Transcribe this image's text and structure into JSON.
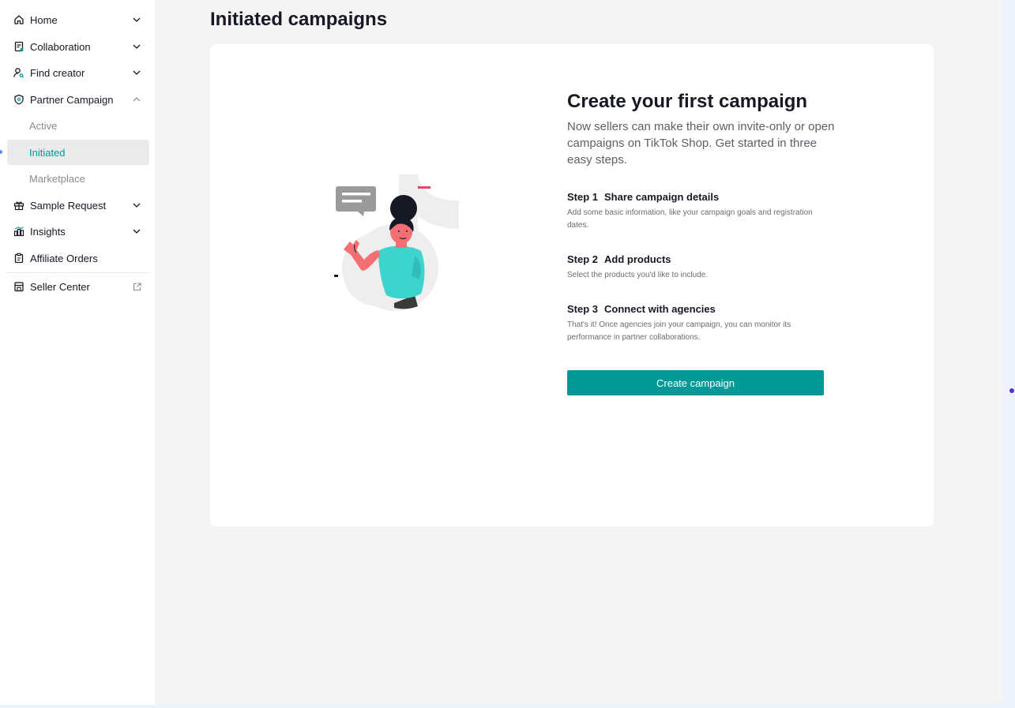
{
  "sidebar": {
    "items": [
      {
        "label": "Home",
        "icon": "home-icon"
      },
      {
        "label": "Collaboration",
        "icon": "document-icon"
      },
      {
        "label": "Find creator",
        "icon": "user-search-icon"
      },
      {
        "label": "Partner Campaign",
        "icon": "shield-icon"
      },
      {
        "label": "Sample Request",
        "icon": "gift-icon"
      },
      {
        "label": "Insights",
        "icon": "chart-icon"
      },
      {
        "label": "Affiliate Orders",
        "icon": "clipboard-icon"
      },
      {
        "label": "Seller Center",
        "icon": "store-icon"
      }
    ],
    "sub_items": [
      {
        "label": "Active"
      },
      {
        "label": "Initiated"
      },
      {
        "label": "Marketplace"
      }
    ]
  },
  "page": {
    "title": "Initiated campaigns"
  },
  "empty_state": {
    "title": "Create your first campaign",
    "description": "Now sellers can make their own invite-only or open campaigns on TikTok Shop. Get started in three easy steps.",
    "steps": [
      {
        "number": "Step 1",
        "title": "Share campaign details",
        "description": "Add some basic information, like your campaign goals and registration dates."
      },
      {
        "number": "Step 2",
        "title": "Add products",
        "description": "Select the products you'd like to include."
      },
      {
        "number": "Step 3",
        "title": "Connect with agencies",
        "description": "That's it! Once agencies join your campaign, you can monitor its performance in partner collaborations."
      }
    ],
    "button_label": "Create campaign"
  },
  "colors": {
    "accent": "#009995",
    "active_bg": "#ebebeb",
    "page_bg": "#f4f4f4"
  }
}
